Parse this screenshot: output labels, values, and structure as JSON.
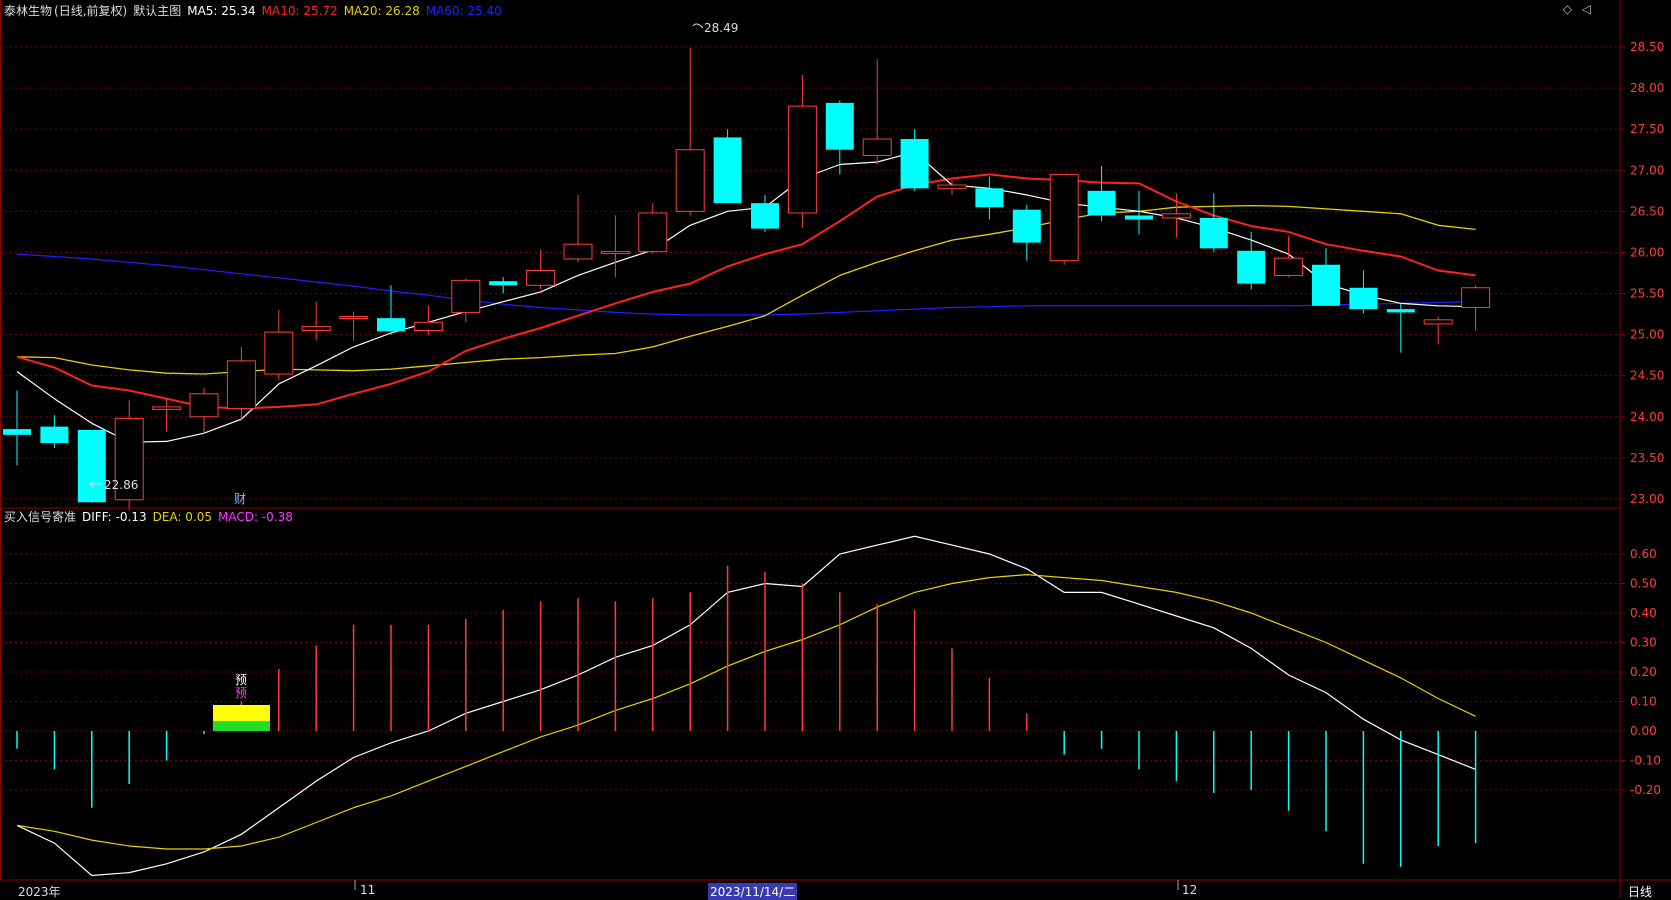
{
  "stock": {
    "name": "泰林生物",
    "mode": "(日线,前复权)",
    "template": "默认主图"
  },
  "ma": [
    {
      "label": "MA5:",
      "value": "25.34",
      "color": "#ffffff"
    },
    {
      "label": "MA10:",
      "value": "25.72",
      "color": "#ff2020"
    },
    {
      "label": "MA20:",
      "value": "26.28",
      "color": "#e6d200"
    },
    {
      "label": "MA60:",
      "value": "25.40",
      "color": "#2020ff"
    }
  ],
  "macd_legend": {
    "title": "买入信号寄准",
    "items": [
      {
        "label": "DIFF:",
        "value": "-0.13",
        "color": "#ffffff"
      },
      {
        "label": "DEA:",
        "value": "0.05",
        "color": "#e6d200"
      },
      {
        "label": "MACD:",
        "value": "-0.38",
        "color": "#ff33ff"
      }
    ]
  },
  "annotations": {
    "high_label": "28.49",
    "low_label": "22.86",
    "cai_marker": "财",
    "yu1": "预",
    "yu2": "预"
  },
  "corner": {
    "diamond": "◇",
    "tri": "◁"
  },
  "x_labels": {
    "year": "2023年",
    "nov": "11",
    "cursor_date": "2023/11/14/二",
    "dec": "12"
  },
  "period_tab": "日线",
  "colors": {
    "up": "#ff3b3b",
    "down": "#00ffff",
    "grid": "#7a0000",
    "axis": "#8b0000",
    "background": "#000000"
  },
  "chart_data": [
    {
      "type": "candlestick",
      "title": "泰林生物",
      "ylim": [
        22.7,
        28.7
      ],
      "yticks": [
        23.0,
        23.5,
        24.0,
        24.5,
        25.0,
        25.5,
        26.0,
        26.5,
        27.0,
        27.5,
        28.0,
        28.5
      ],
      "ohlc": [
        [
          23.85,
          24.32,
          23.41,
          23.78
        ],
        [
          23.88,
          24.02,
          23.62,
          23.68
        ],
        [
          23.84,
          23.84,
          22.95,
          22.96
        ],
        [
          22.99,
          24.2,
          22.86,
          23.98
        ],
        [
          24.09,
          24.22,
          23.82,
          24.12
        ],
        [
          24.0,
          24.35,
          23.8,
          24.28
        ],
        [
          24.1,
          24.85,
          23.95,
          24.68
        ],
        [
          24.52,
          25.3,
          24.45,
          25.03
        ],
        [
          25.05,
          25.4,
          24.93,
          25.1
        ],
        [
          25.2,
          25.28,
          24.92,
          25.22
        ],
        [
          25.2,
          25.6,
          25.0,
          25.04
        ],
        [
          25.05,
          25.35,
          24.99,
          25.15
        ],
        [
          25.27,
          25.68,
          25.15,
          25.66
        ],
        [
          25.65,
          25.7,
          25.5,
          25.6
        ],
        [
          25.6,
          26.03,
          25.55,
          25.78
        ],
        [
          25.92,
          26.7,
          25.88,
          26.1
        ],
        [
          25.99,
          26.45,
          25.7,
          26.01
        ],
        [
          26.01,
          26.6,
          25.98,
          26.48
        ],
        [
          26.5,
          28.49,
          26.45,
          27.25
        ],
        [
          27.4,
          27.5,
          26.6,
          26.6
        ],
        [
          26.6,
          26.7,
          26.25,
          26.29
        ],
        [
          26.48,
          28.16,
          26.3,
          27.78
        ],
        [
          27.82,
          27.85,
          26.95,
          27.25
        ],
        [
          27.18,
          28.35,
          27.07,
          27.38
        ],
        [
          27.38,
          27.5,
          26.75,
          26.78
        ],
        [
          26.78,
          26.88,
          26.7,
          26.82
        ],
        [
          26.78,
          26.92,
          26.4,
          26.55
        ],
        [
          26.52,
          26.58,
          25.9,
          26.12
        ],
        [
          25.9,
          26.95,
          25.85,
          26.95
        ],
        [
          26.75,
          27.05,
          26.38,
          26.45
        ],
        [
          26.45,
          26.75,
          26.22,
          26.4
        ],
        [
          26.42,
          26.72,
          26.18,
          26.47
        ],
        [
          26.42,
          26.72,
          26.0,
          26.05
        ],
        [
          26.02,
          26.25,
          25.55,
          25.62
        ],
        [
          25.72,
          26.2,
          25.7,
          25.93
        ],
        [
          25.85,
          26.05,
          25.38,
          25.35
        ],
        [
          25.57,
          25.78,
          25.26,
          25.31
        ],
        [
          25.31,
          25.38,
          24.78,
          25.27
        ],
        [
          25.13,
          25.22,
          24.88,
          25.18
        ],
        [
          25.33,
          25.6,
          25.05,
          25.57
        ]
      ],
      "ma5": [
        24.55,
        24.22,
        23.92,
        23.69,
        23.7,
        23.8,
        23.97,
        24.4,
        24.62,
        24.85,
        25.02,
        25.15,
        25.28,
        25.4,
        25.52,
        25.72,
        25.88,
        26.03,
        26.33,
        26.5,
        26.55,
        26.9,
        27.07,
        27.1,
        27.22,
        26.82,
        26.78,
        26.7,
        26.6,
        26.55,
        26.5,
        26.42,
        26.3,
        26.15,
        25.98,
        25.62,
        25.48,
        25.38,
        25.35,
        25.34
      ],
      "ma10": [
        24.73,
        24.6,
        24.38,
        24.32,
        24.22,
        24.12,
        24.1,
        24.12,
        24.15,
        24.28,
        24.4,
        24.55,
        24.8,
        24.95,
        25.08,
        25.23,
        25.38,
        25.52,
        25.62,
        25.83,
        25.98,
        26.1,
        26.38,
        26.68,
        26.82,
        26.9,
        26.95,
        26.9,
        26.88,
        26.85,
        26.84,
        26.62,
        26.45,
        26.32,
        26.25,
        26.1,
        26.02,
        25.95,
        25.78,
        25.72
      ],
      "ma20": [
        24.73,
        24.72,
        24.63,
        24.57,
        24.53,
        24.52,
        24.55,
        24.58,
        24.57,
        24.56,
        24.58,
        24.62,
        24.66,
        24.7,
        24.72,
        24.75,
        24.77,
        24.85,
        24.98,
        25.1,
        25.23,
        25.48,
        25.72,
        25.88,
        26.02,
        26.15,
        26.22,
        26.3,
        26.4,
        26.48,
        26.5,
        26.55,
        26.56,
        26.57,
        26.56,
        26.53,
        26.5,
        26.47,
        26.33,
        26.28
      ],
      "ma60": [
        25.98,
        25.95,
        25.92,
        25.88,
        25.84,
        25.79,
        25.74,
        25.69,
        25.64,
        25.59,
        25.53,
        25.48,
        25.42,
        25.37,
        25.33,
        25.3,
        25.27,
        25.25,
        25.24,
        25.24,
        25.24,
        25.25,
        25.27,
        25.29,
        25.31,
        25.33,
        25.34,
        25.35,
        25.35,
        25.35,
        25.35,
        25.35,
        25.35,
        25.35,
        25.35,
        25.36,
        25.37,
        25.38,
        25.39,
        25.4
      ]
    },
    {
      "type": "macd",
      "ylim": [
        -0.56,
        0.72
      ],
      "yticks": [
        -0.2,
        -0.1,
        0.0,
        0.1,
        0.2,
        0.3,
        0.4,
        0.5,
        0.6
      ],
      "diff": [
        -0.32,
        -0.38,
        -0.49,
        -0.48,
        -0.45,
        -0.41,
        -0.35,
        -0.26,
        -0.17,
        -0.09,
        -0.04,
        0.0,
        0.06,
        0.1,
        0.14,
        0.19,
        0.25,
        0.29,
        0.36,
        0.47,
        0.5,
        0.49,
        0.6,
        0.63,
        0.66,
        0.63,
        0.6,
        0.55,
        0.47,
        0.47,
        0.43,
        0.39,
        0.35,
        0.28,
        0.19,
        0.13,
        0.04,
        -0.03,
        -0.08,
        -0.13
      ],
      "dea": [
        -0.32,
        -0.34,
        -0.37,
        -0.39,
        -0.4,
        -0.4,
        -0.39,
        -0.36,
        -0.31,
        -0.26,
        -0.22,
        -0.17,
        -0.12,
        -0.07,
        -0.02,
        0.02,
        0.07,
        0.11,
        0.16,
        0.22,
        0.27,
        0.31,
        0.36,
        0.42,
        0.47,
        0.5,
        0.52,
        0.53,
        0.52,
        0.51,
        0.49,
        0.47,
        0.44,
        0.4,
        0.35,
        0.3,
        0.24,
        0.18,
        0.11,
        0.05
      ],
      "macd": [
        -0.06,
        -0.13,
        -0.26,
        -0.18,
        -0.1,
        -0.01,
        0.1,
        0.21,
        0.29,
        0.36,
        0.36,
        0.36,
        0.38,
        0.41,
        0.44,
        0.45,
        0.44,
        0.45,
        0.47,
        0.56,
        0.54,
        0.5,
        0.47,
        0.43,
        0.41,
        0.28,
        0.18,
        0.06,
        -0.08,
        -0.06,
        -0.13,
        -0.17,
        -0.21,
        -0.2,
        -0.27,
        -0.34,
        -0.45,
        -0.46,
        -0.39,
        -0.38
      ]
    }
  ]
}
